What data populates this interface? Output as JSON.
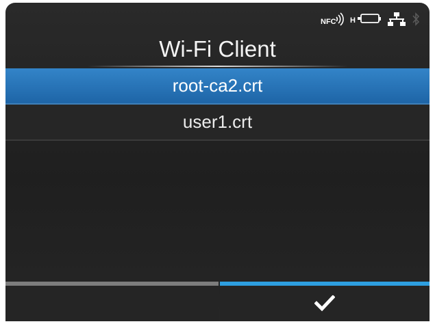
{
  "status": {
    "icons": [
      "nfc-icon",
      "battery-icon",
      "network-icon",
      "bluetooth-icon"
    ],
    "nfc_label": "NFC",
    "battery_label": "H"
  },
  "header": {
    "title": "Wi-Fi Client"
  },
  "list": {
    "items": [
      {
        "label": "root-ca2.crt",
        "selected": true
      },
      {
        "label": "user1.crt",
        "selected": false
      }
    ]
  },
  "softkeys": {
    "left": {
      "icon": ""
    },
    "right": {
      "icon": "checkmark-icon"
    }
  },
  "colors": {
    "accent": "#2e9fe0",
    "selected_row": "#2a78bd",
    "background": "#242424"
  }
}
